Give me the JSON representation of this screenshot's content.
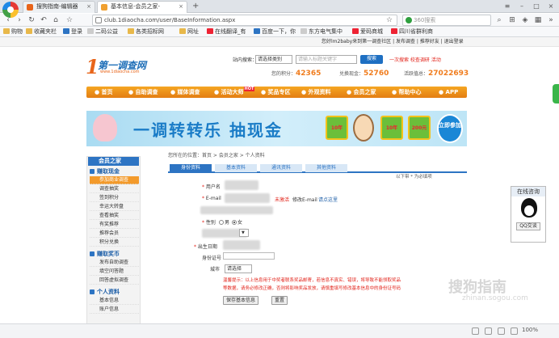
{
  "browser": {
    "tabs": [
      {
        "label": "搜狗指南-编辑器",
        "active": false
      },
      {
        "label": "基本信息-会员之家-",
        "active": true
      }
    ],
    "new_tab": "+",
    "address": "club.1diaocha.com/user/BaseInformation.aspx",
    "search_placeholder": "360搜索",
    "bookmarks": [
      "购物",
      "收藏夹栏",
      "登录",
      "二码公益",
      "各类招标网",
      "网址",
      "在线翻译_有",
      "百度一下，你",
      "东方电气集中",
      "爱码商城",
      "四川省群利商"
    ],
    "zoom": "100%"
  },
  "site": {
    "topbar": "您好lm2baby来到第一调查社区 | 发布调查 | 推荐好友 | 退出登录",
    "logo_main": "第一调查网",
    "logo_url": "www.1diaocha.com",
    "search_label": "站内搜索：",
    "search_select": "请选择类别",
    "search_placeholder": "请输入标题关键字",
    "search_button": "搜索",
    "search_links": "一次搜索  校查调研  活动",
    "stats": [
      {
        "label": "您的积分",
        "value": "42365"
      },
      {
        "label": "兑换现金",
        "value": "52760"
      },
      {
        "label": "活跃值总",
        "value": "27022693"
      }
    ],
    "menu": [
      "首页",
      "自助调查",
      "媒体调查",
      "活动大师",
      "奖品专区",
      "外观资料",
      "会员之家",
      "帮助中心",
      "APP"
    ],
    "menu_hot": "HOT",
    "banner": {
      "title": "一调转转乐 抽现金",
      "chests": [
        "10年",
        "10年",
        "200元"
      ],
      "cta": "立即参加"
    }
  },
  "sidebar": {
    "header": "会员之家",
    "sections": [
      {
        "title": "赚取现金",
        "items": [
          "参加商业调查",
          "调查抽奖",
          "签到积分",
          "幸运大转盘",
          "查看抽奖",
          "有奖推荐",
          "推荐会员",
          "积分兑换"
        ]
      },
      {
        "title": "赚取奖币",
        "items": [
          "发布自助调查",
          "填空问答题",
          "回答虚拟调查"
        ]
      },
      {
        "title": "个人资料",
        "items": [
          "基本信息",
          "账户信息"
        ]
      }
    ],
    "current": "参加商业调查"
  },
  "content": {
    "breadcrumb": "您所在的位置：首页 > 会员之家 > 个人资料",
    "tabs": [
      "身份资料",
      "基本资料",
      "通讯资料",
      "其他资料"
    ],
    "hint": "以下带 * 为必填项",
    "fields": {
      "username_label": "用户名",
      "email_label": "E-mail",
      "email_status": "未激活",
      "email_modify": "修改E-mail",
      "email_resend": "请点这里",
      "gender_label": "性别",
      "gender_male": "男",
      "gender_female": "女",
      "birth_label": "出生日期",
      "id_label": "身份证号",
      "city_label": "城市",
      "city_select": "请选择"
    },
    "notice": "温馨提示：以上信息用于中奖者联系奖品邮寄，若信息不真实、错误，将导致不能领取奖品",
    "notice2": "等数据，请务必修改正确，否则将影响奖品发放，请慎重填写修改基本信息中的身份证号码",
    "save_button": "保存基本信息",
    "reset_button": "重置"
  },
  "chat": {
    "title": "在线咨询",
    "button": "QQ交谈"
  },
  "watermark": "搜狗指南",
  "watermark_url": "zhinan.sogou.com"
}
